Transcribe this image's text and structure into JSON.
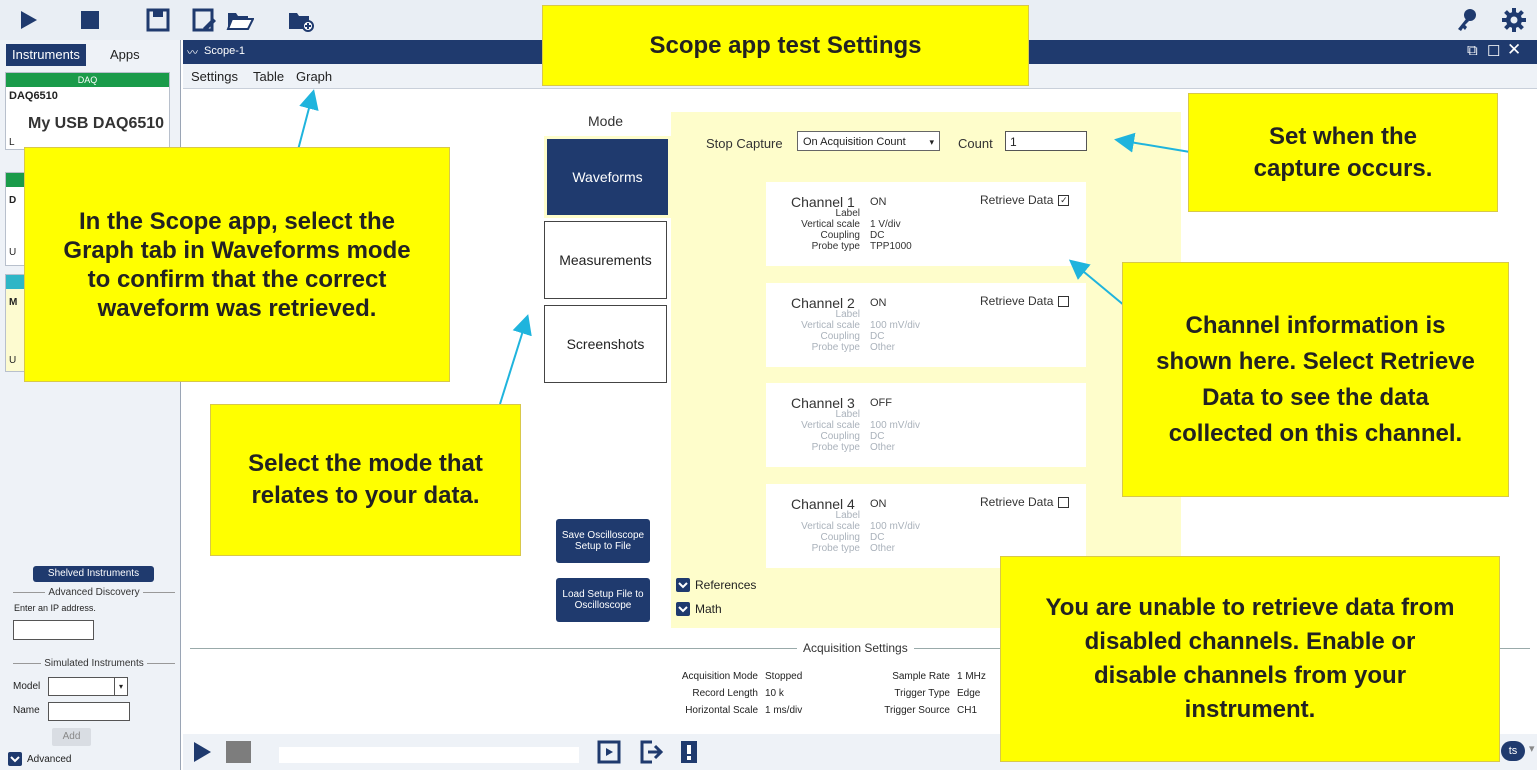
{
  "toolbar": {
    "items": [
      "play-icon",
      "stop-icon",
      "save-icon",
      "save-as-icon",
      "open-icon",
      "new-folder-icon"
    ],
    "right": [
      "key-icon",
      "gear-icon"
    ]
  },
  "left": {
    "tabs": [
      "Instruments",
      "Apps"
    ],
    "cards": [
      {
        "type": "DAQ",
        "model": "DAQ6510",
        "name": "My USB DAQ6510",
        "color": "#1a9b4a"
      },
      {
        "type": "",
        "model": "D",
        "name": "",
        "color": "#1a9b4a"
      },
      {
        "type": "",
        "model": "M",
        "name": "",
        "color": "#2eb6c6"
      }
    ],
    "shelved": "Shelved Instruments",
    "advanced_discovery": "Advanced Discovery",
    "ip_label": "Enter an IP address.",
    "simulated": "Simulated Instruments",
    "model_label": "Model",
    "name_label": "Name",
    "add": "Add",
    "advanced": "Advanced"
  },
  "window": {
    "title": "Scope-1",
    "tabs": [
      "Settings",
      "Table",
      "Graph"
    ]
  },
  "mode": {
    "label": "Mode",
    "buttons": [
      "Waveforms",
      "Measurements",
      "Screenshots"
    ],
    "selected": "Waveforms"
  },
  "actions": {
    "save": "Save Oscilloscope Setup to File",
    "load": "Load Setup File to Oscilloscope"
  },
  "capture": {
    "stop_label": "Stop Capture",
    "stop_value": "On Acquisition Count",
    "count_label": "Count",
    "count_value": "1"
  },
  "field_labels": {
    "label": "Label",
    "vertical_scale": "Vertical scale",
    "coupling": "Coupling",
    "probe_type": "Probe type",
    "retrieve": "Retrieve Data"
  },
  "channels": [
    {
      "name": "Channel 1",
      "state": "ON",
      "vscale": "1 V/div",
      "coupling": "DC",
      "probe": "TPP1000",
      "retrieve": true,
      "show_retrieve": true,
      "active": true
    },
    {
      "name": "Channel 2",
      "state": "ON",
      "vscale": "100 mV/div",
      "coupling": "DC",
      "probe": "Other",
      "retrieve": false,
      "show_retrieve": true,
      "active": false
    },
    {
      "name": "Channel 3",
      "state": "OFF",
      "vscale": "100 mV/div",
      "coupling": "DC",
      "probe": "Other",
      "retrieve": false,
      "show_retrieve": false,
      "active": false
    },
    {
      "name": "Channel 4",
      "state": "ON",
      "vscale": "100 mV/div",
      "coupling": "DC",
      "probe": "Other",
      "retrieve": false,
      "show_retrieve": true,
      "active": false
    }
  ],
  "expanders": [
    "References",
    "Math"
  ],
  "acquisition": {
    "title": "Acquisition Settings",
    "left": [
      [
        "Acquisition Mode",
        "Stopped"
      ],
      [
        "Record Length",
        "10 k"
      ],
      [
        "Horizontal Scale",
        "1 ms/div"
      ]
    ],
    "right": [
      [
        "Sample Rate",
        "1 MHz"
      ],
      [
        "Trigger Type",
        "Edge"
      ],
      [
        "Trigger Source",
        "CH1"
      ]
    ]
  },
  "bottom": {
    "right_label": "ts"
  },
  "callouts": {
    "title": "Scope app test Settings",
    "graph": "In the Scope app, select the Graph tab in Waveforms mode to confirm that the correct waveform was retrieved.",
    "mode": "Select the mode that relates to your data.",
    "capture": "Set when the capture occurs.",
    "channel": "Channel information is shown here. Select Retrieve Data to see the data collected on this channel.",
    "disabled": "You are unable to retrieve data from disabled channels. Enable or disable channels from your instrument."
  },
  "colors": {
    "navy": "#1f3a6e",
    "callout": "#ffff00",
    "panel": "#fefdcb",
    "arrow": "#1fb4dd"
  }
}
